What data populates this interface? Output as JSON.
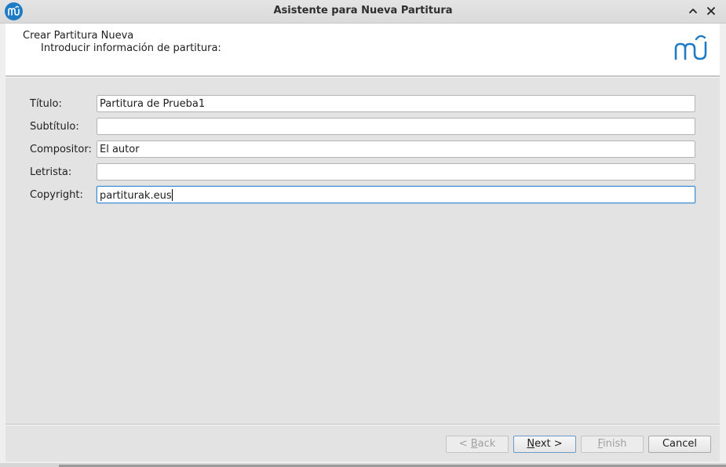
{
  "window": {
    "title": "Asistente para Nueva Partitura"
  },
  "header": {
    "title": "Crear Partitura Nueva",
    "subtitle": "Introducir información de partitura:",
    "logo_icon": "musescore-logo-icon"
  },
  "form": {
    "fields": [
      {
        "label": "Título:",
        "value": "Partitura de Prueba1"
      },
      {
        "label": "Subtítulo:",
        "value": ""
      },
      {
        "label": "Compositor:",
        "value": "El autor"
      },
      {
        "label": "Letrista:",
        "value": ""
      },
      {
        "label": "Copyright:",
        "value": "partiturak.eus",
        "focused": true
      }
    ]
  },
  "buttons": {
    "back": {
      "prefix": "< ",
      "mnemonic": "B",
      "rest": "ack",
      "enabled": false
    },
    "next": {
      "mnemonic": "N",
      "rest": "ext >",
      "enabled": true
    },
    "finish": {
      "mnemonic": "F",
      "rest": "inish",
      "enabled": false
    },
    "cancel": {
      "label": "Cancel",
      "enabled": true
    }
  },
  "colors": {
    "accent": "#1f7bc4",
    "focus_border": "#3f8fd2"
  }
}
